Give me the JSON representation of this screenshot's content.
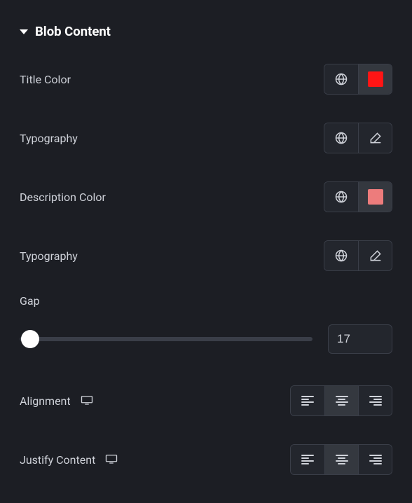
{
  "section": {
    "title": "Blob Content"
  },
  "rows": {
    "title_color": {
      "label": "Title Color",
      "swatch": "#ff1515"
    },
    "typography1": {
      "label": "Typography"
    },
    "description_color": {
      "label": "Description Color",
      "swatch": "#ed7c7c"
    },
    "typography2": {
      "label": "Typography"
    }
  },
  "gap": {
    "label": "Gap",
    "value": "17"
  },
  "alignment": {
    "label": "Alignment",
    "options": [
      "left",
      "center",
      "right"
    ],
    "active": "center"
  },
  "justify": {
    "label": "Justify Content",
    "options": [
      "start",
      "center",
      "end"
    ],
    "active": "center"
  }
}
